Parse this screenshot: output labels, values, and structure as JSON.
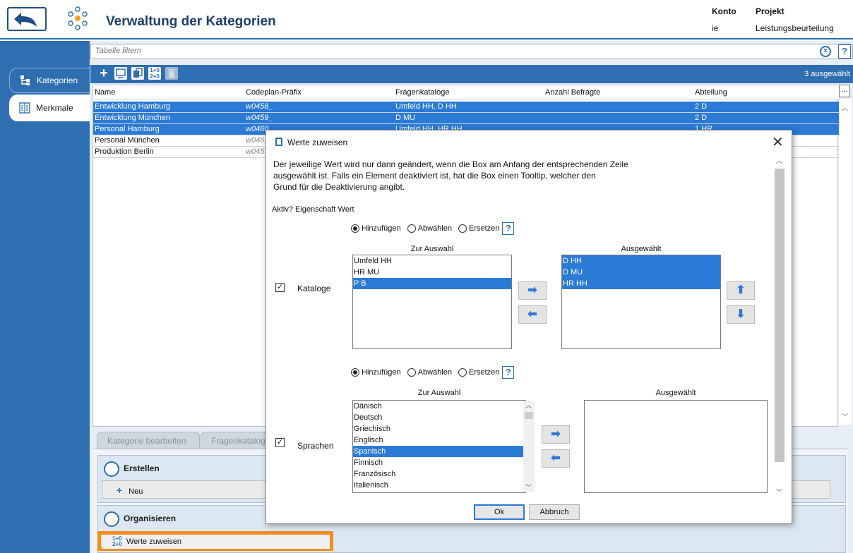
{
  "header": {
    "title": "Verwaltung der Kategorien",
    "konto_label": "Konto",
    "konto_value": "ie",
    "projekt_label": "Projekt",
    "projekt_value": "Leistungsbeurteilung"
  },
  "nav": {
    "items": [
      {
        "label": "Kategorien",
        "active": true
      },
      {
        "label": "Merkmale",
        "active": false
      }
    ]
  },
  "filter": {
    "placeholder": "Tabelle filtern",
    "clear_icon": "clear-circle-icon",
    "help": "?"
  },
  "toolbar": {
    "selected_count": "3 ausgewählt"
  },
  "table": {
    "columns": [
      "Name",
      "Codeplan-Präfix",
      "Fragenkataloge",
      "Anzahl Befragte",
      "Abteilung"
    ],
    "more": "...",
    "rows": [
      {
        "name": "Entwicklung Hamburg",
        "code": "w0458_",
        "kataloge": "Umfeld HH, D HH",
        "anzahl": "",
        "abteilung": "2 D",
        "selected": true
      },
      {
        "name": "Entwicklung München",
        "code": "w0459_",
        "kataloge": "D MU",
        "anzahl": "",
        "abteilung": "2 D",
        "selected": true
      },
      {
        "name": "Personal Hamburg",
        "code": "w0460_",
        "kataloge": "Umfeld HH, HR HH",
        "anzahl": "",
        "abteilung": "1 HR",
        "selected": true
      },
      {
        "name": "Personal München",
        "code": "w0461",
        "kataloge": "",
        "anzahl": "",
        "abteilung": "",
        "selected": false
      },
      {
        "name": "Produktion Berlin",
        "code": "w0457",
        "kataloge": "",
        "anzahl": "",
        "abteilung": "",
        "selected": false
      }
    ]
  },
  "bottom_tabs": [
    "Kategorie bearbeiten",
    "Fragenkatalog"
  ],
  "sections": {
    "create": {
      "title": "Erstellen",
      "button": "Neu"
    },
    "organize": {
      "title": "Organisieren",
      "button": "Werte zuweisen",
      "button_icon_text": "1+0\n2+0"
    }
  },
  "dialog": {
    "title": "Werte zuweisen",
    "close": "✕",
    "intro_lines": [
      "Der jeweilige Wert wird nur dann geändert, wenn die Box am Anfang der entsprechenden Zeile",
      "ausgewählt ist. Falls ein Element deaktiviert ist, hat die Box einen Tooltip, welcher den",
      "Grund für die Deaktivierung angibt."
    ],
    "header_row": "Aktiv? Eigenschaft Wert",
    "radio_options": [
      "Hinzufügen",
      "Abwählen",
      "Ersetzen"
    ],
    "help": "?",
    "kataloge": {
      "checked": true,
      "label": "Kataloge",
      "left_caption": "Zur Auswahl",
      "right_caption": "Ausgewählt",
      "available": [
        {
          "label": "Umfeld HH",
          "selected": false
        },
        {
          "label": "HR MU",
          "selected": false
        },
        {
          "label": "P B",
          "selected": true
        }
      ],
      "chosen": [
        {
          "label": "D HH",
          "selected": true
        },
        {
          "label": "D MU",
          "selected": true
        },
        {
          "label": "HR HH",
          "selected": true
        }
      ]
    },
    "sprachen": {
      "checked": true,
      "label": "Sprachen",
      "left_caption": "Zur Auswahl",
      "right_caption": "Ausgewählt",
      "available": [
        {
          "label": "Dänisch",
          "selected": false
        },
        {
          "label": "Deutsch",
          "selected": false
        },
        {
          "label": "Griechisch",
          "selected": false
        },
        {
          "label": "Englisch",
          "selected": false
        },
        {
          "label": "Spanisch",
          "selected": true
        },
        {
          "label": "Finnisch",
          "selected": false
        },
        {
          "label": "Französisch",
          "selected": false
        },
        {
          "label": "Italienisch",
          "selected": false
        }
      ],
      "chosen": []
    },
    "ok": "Ok",
    "cancel": "Abbruch"
  },
  "colors": {
    "accent": "#2f6eb0",
    "selection": "#2a7ad6",
    "highlight_outline": "#f28c1c"
  }
}
